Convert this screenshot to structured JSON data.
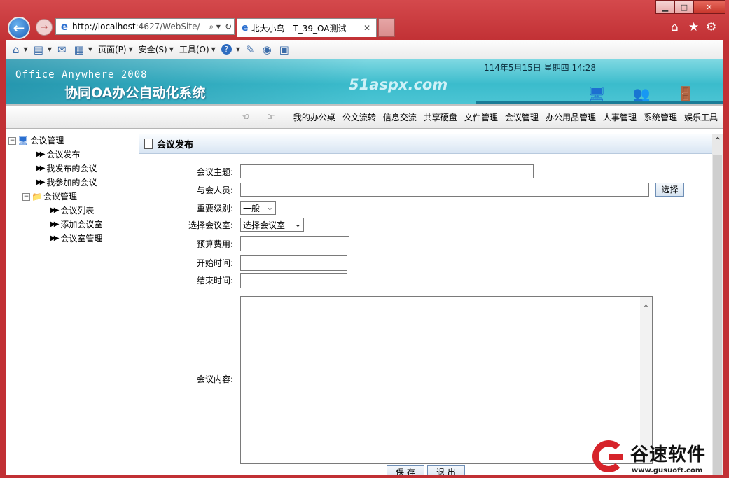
{
  "browser": {
    "address": "http://localhost:4627/WebSite/",
    "address_host": "http://localhost",
    "address_rest": ":4627/WebSite/",
    "tab_title": "北大小鸟 - T_39_OA测试",
    "tab_close": "✕",
    "caption": {
      "minimize": "▁",
      "maximize": "□",
      "close": "✕"
    },
    "right_icons": {
      "home": "⌂",
      "favorites": "★",
      "tools": "⚙"
    },
    "commandbar": {
      "page": "页面(P)",
      "safety": "安全(S)",
      "tools": "工具(O)",
      "help": "?"
    }
  },
  "banner": {
    "product": "Office Anywhere 2008",
    "system_title": "协同OA办公自动化系统",
    "watermark": "51aspx.com",
    "datetime": "114年5月15日 星期四 14:28"
  },
  "topnav": {
    "items": [
      "我的办公桌",
      "公文流转",
      "信息交流",
      "共享硬盘",
      "文件管理",
      "会议管理",
      "办公用品管理",
      "人事管理",
      "系统管理",
      "娱乐工具"
    ]
  },
  "tree": {
    "root": "会议管理",
    "items": [
      "会议发布",
      "我发布的会议",
      "我参加的会议"
    ],
    "folder": "会议管理",
    "sub_items": [
      "会议列表",
      "添加会议室",
      "会议室管理"
    ]
  },
  "form": {
    "header": "会议发布",
    "subject_label": "会议主题:",
    "attendees_label": "与会人员:",
    "choose_button": "选择",
    "priority_label": "重要级别:",
    "priority_value": "一般",
    "room_label": "选择会议室:",
    "room_value": "选择会议室",
    "budget_label": "预算费用:",
    "start_label": "开始时间:",
    "end_label": "结束时间:",
    "content_label": "会议内容:",
    "save_button": "保 存",
    "exit_button": "退 出"
  },
  "watermark_logo": {
    "name": "谷速软件",
    "url": "www.gusuoft.com"
  }
}
